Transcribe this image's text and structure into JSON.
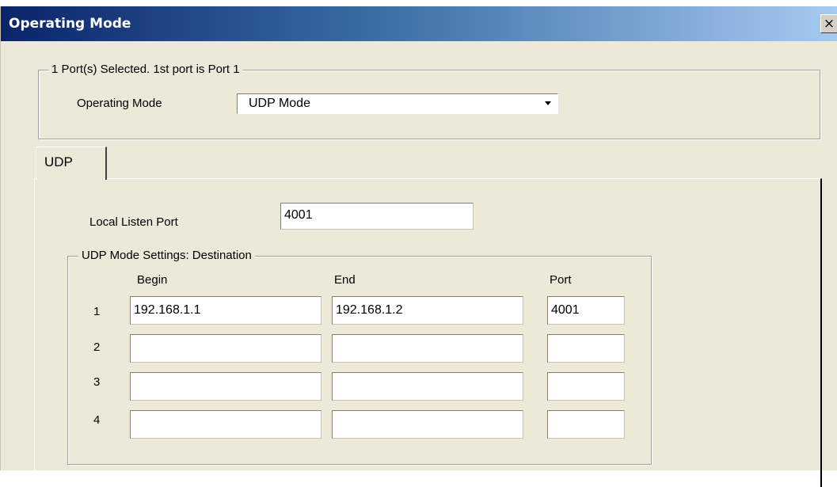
{
  "window": {
    "title": "Operating Mode",
    "close_glyph": "✕"
  },
  "port_selection": {
    "summary": "1 Port(s) Selected. 1st port is Port 1",
    "mode_label": "Operating Mode",
    "mode_value": "UDP Mode"
  },
  "tabs": [
    {
      "label": "UDP"
    }
  ],
  "udp": {
    "local_listen_port_label": "Local Listen Port",
    "local_listen_port_value": "4001",
    "destination_group_label": "UDP Mode Settings: Destination",
    "columns": {
      "begin": "Begin",
      "end": "End",
      "port": "Port"
    },
    "rows": [
      {
        "index": "1",
        "begin": "192.168.1.1",
        "end": "192.168.1.2",
        "port": "4001"
      },
      {
        "index": "2",
        "begin": "",
        "end": "",
        "port": ""
      },
      {
        "index": "3",
        "begin": "",
        "end": "",
        "port": ""
      },
      {
        "index": "4",
        "begin": "",
        "end": "",
        "port": ""
      }
    ]
  }
}
